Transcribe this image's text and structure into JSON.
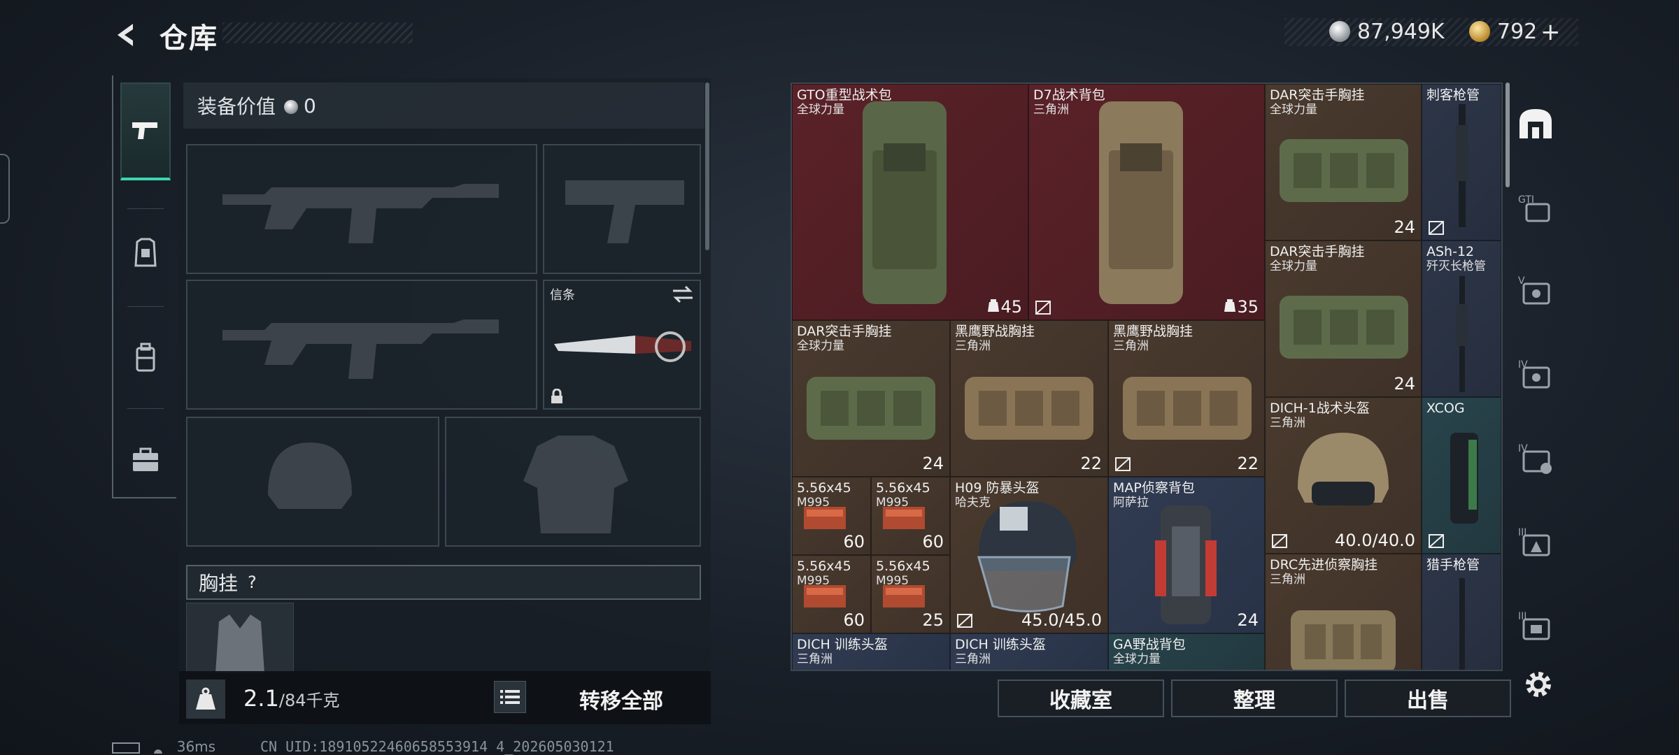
{
  "header": {
    "title": "仓库"
  },
  "currency": {
    "silver": "87,949K",
    "gold": "792",
    "gold_plus": "+"
  },
  "left": {
    "equip_value_label": "装备价值",
    "equip_value": "0",
    "melee_label": "信条",
    "vest_label": "胸挂",
    "vest_help": "?",
    "weight": "2.1",
    "weight_max": "/84千克",
    "transfer_all": "转移全部"
  },
  "grid": {
    "items": [
      {
        "name": "GTO重型战术包",
        "sub": "全球力量",
        "count": "45",
        "color": "red",
        "icon": "backpack"
      },
      {
        "name": "D7战术背包",
        "sub": "三角洲",
        "count": "35",
        "color": "red",
        "icon": "backpack"
      },
      {
        "name": "DAR突击手胸挂",
        "sub": "全球力量",
        "count": "24",
        "color": "brown",
        "icon": "vest"
      },
      {
        "name": "刺客枪管",
        "sub": "",
        "count": "",
        "color": "blue",
        "icon": "barrel"
      },
      {
        "name": "DAR突击手胸挂",
        "sub": "全球力量",
        "count": "24",
        "color": "brown",
        "icon": "vest"
      },
      {
        "name": "ASh-12",
        "sub": "歼灭长枪管",
        "count": "",
        "color": "blue",
        "icon": "barrel"
      },
      {
        "name": "DAR突击手胸挂",
        "sub": "全球力量",
        "count": "24",
        "color": "brown",
        "icon": "vest"
      },
      {
        "name": "黑鹰野战胸挂",
        "sub": "三角洲",
        "count": "22",
        "color": "brown",
        "icon": "vest"
      },
      {
        "name": "黑鹰野战胸挂",
        "sub": "三角洲",
        "count": "22",
        "color": "brown",
        "icon": "vest"
      },
      {
        "name": "DICH-1战术头盔",
        "sub": "三角洲",
        "count": "40.0/40.0",
        "color": "brown",
        "icon": "helmet"
      },
      {
        "name": "XCOG",
        "sub": "",
        "count": "",
        "color": "blue",
        "icon": "scope"
      },
      {
        "name": "5.56x45",
        "sub": "M995",
        "count": "60",
        "color": "brown",
        "icon": "ammo"
      },
      {
        "name": "5.56x45",
        "sub": "M995",
        "count": "60",
        "color": "brown",
        "icon": "ammo"
      },
      {
        "name": "H09 防暴头盔",
        "sub": "哈夫克",
        "count": "45.0/45.0",
        "color": "brown",
        "icon": "helmet"
      },
      {
        "name": "MAP侦察背包",
        "sub": "阿萨拉",
        "count": "24",
        "color": "navyblue",
        "icon": "backpack"
      },
      {
        "name": "5.56x45",
        "sub": "M995",
        "count": "60",
        "color": "brown",
        "icon": "ammo"
      },
      {
        "name": "5.56x45",
        "sub": "M995",
        "count": "25",
        "color": "brown",
        "icon": "ammo"
      },
      {
        "name": "DRC先进侦察胸挂",
        "sub": "三角洲",
        "count": "",
        "color": "brown",
        "icon": "vest"
      },
      {
        "name": "猎手枪管",
        "sub": "",
        "count": "",
        "color": "blue",
        "icon": "barrel"
      },
      {
        "name": "DICH 训练头盔",
        "sub": "三角洲",
        "count": "",
        "color": "blue",
        "icon": "helmet"
      },
      {
        "name": "DICH 训练头盔",
        "sub": "三角洲",
        "count": "",
        "color": "blue",
        "icon": "helmet"
      },
      {
        "name": "GA野战背包",
        "sub": "全球力量",
        "count": "",
        "color": "teal",
        "icon": "backpack"
      }
    ]
  },
  "buttons": {
    "collection": "收藏室",
    "organize": "整理",
    "sell": "出售"
  },
  "right_tabs": [
    "warehouse-icon",
    "GTI-case-icon",
    "V-case-icon",
    "IV-case-icon",
    "IV-lock-case-icon",
    "III-case-icon",
    "III-case2-icon"
  ],
  "status": {
    "ping": "36ms",
    "uid": "CN UID:18910522460658553914 4_202605030121"
  }
}
